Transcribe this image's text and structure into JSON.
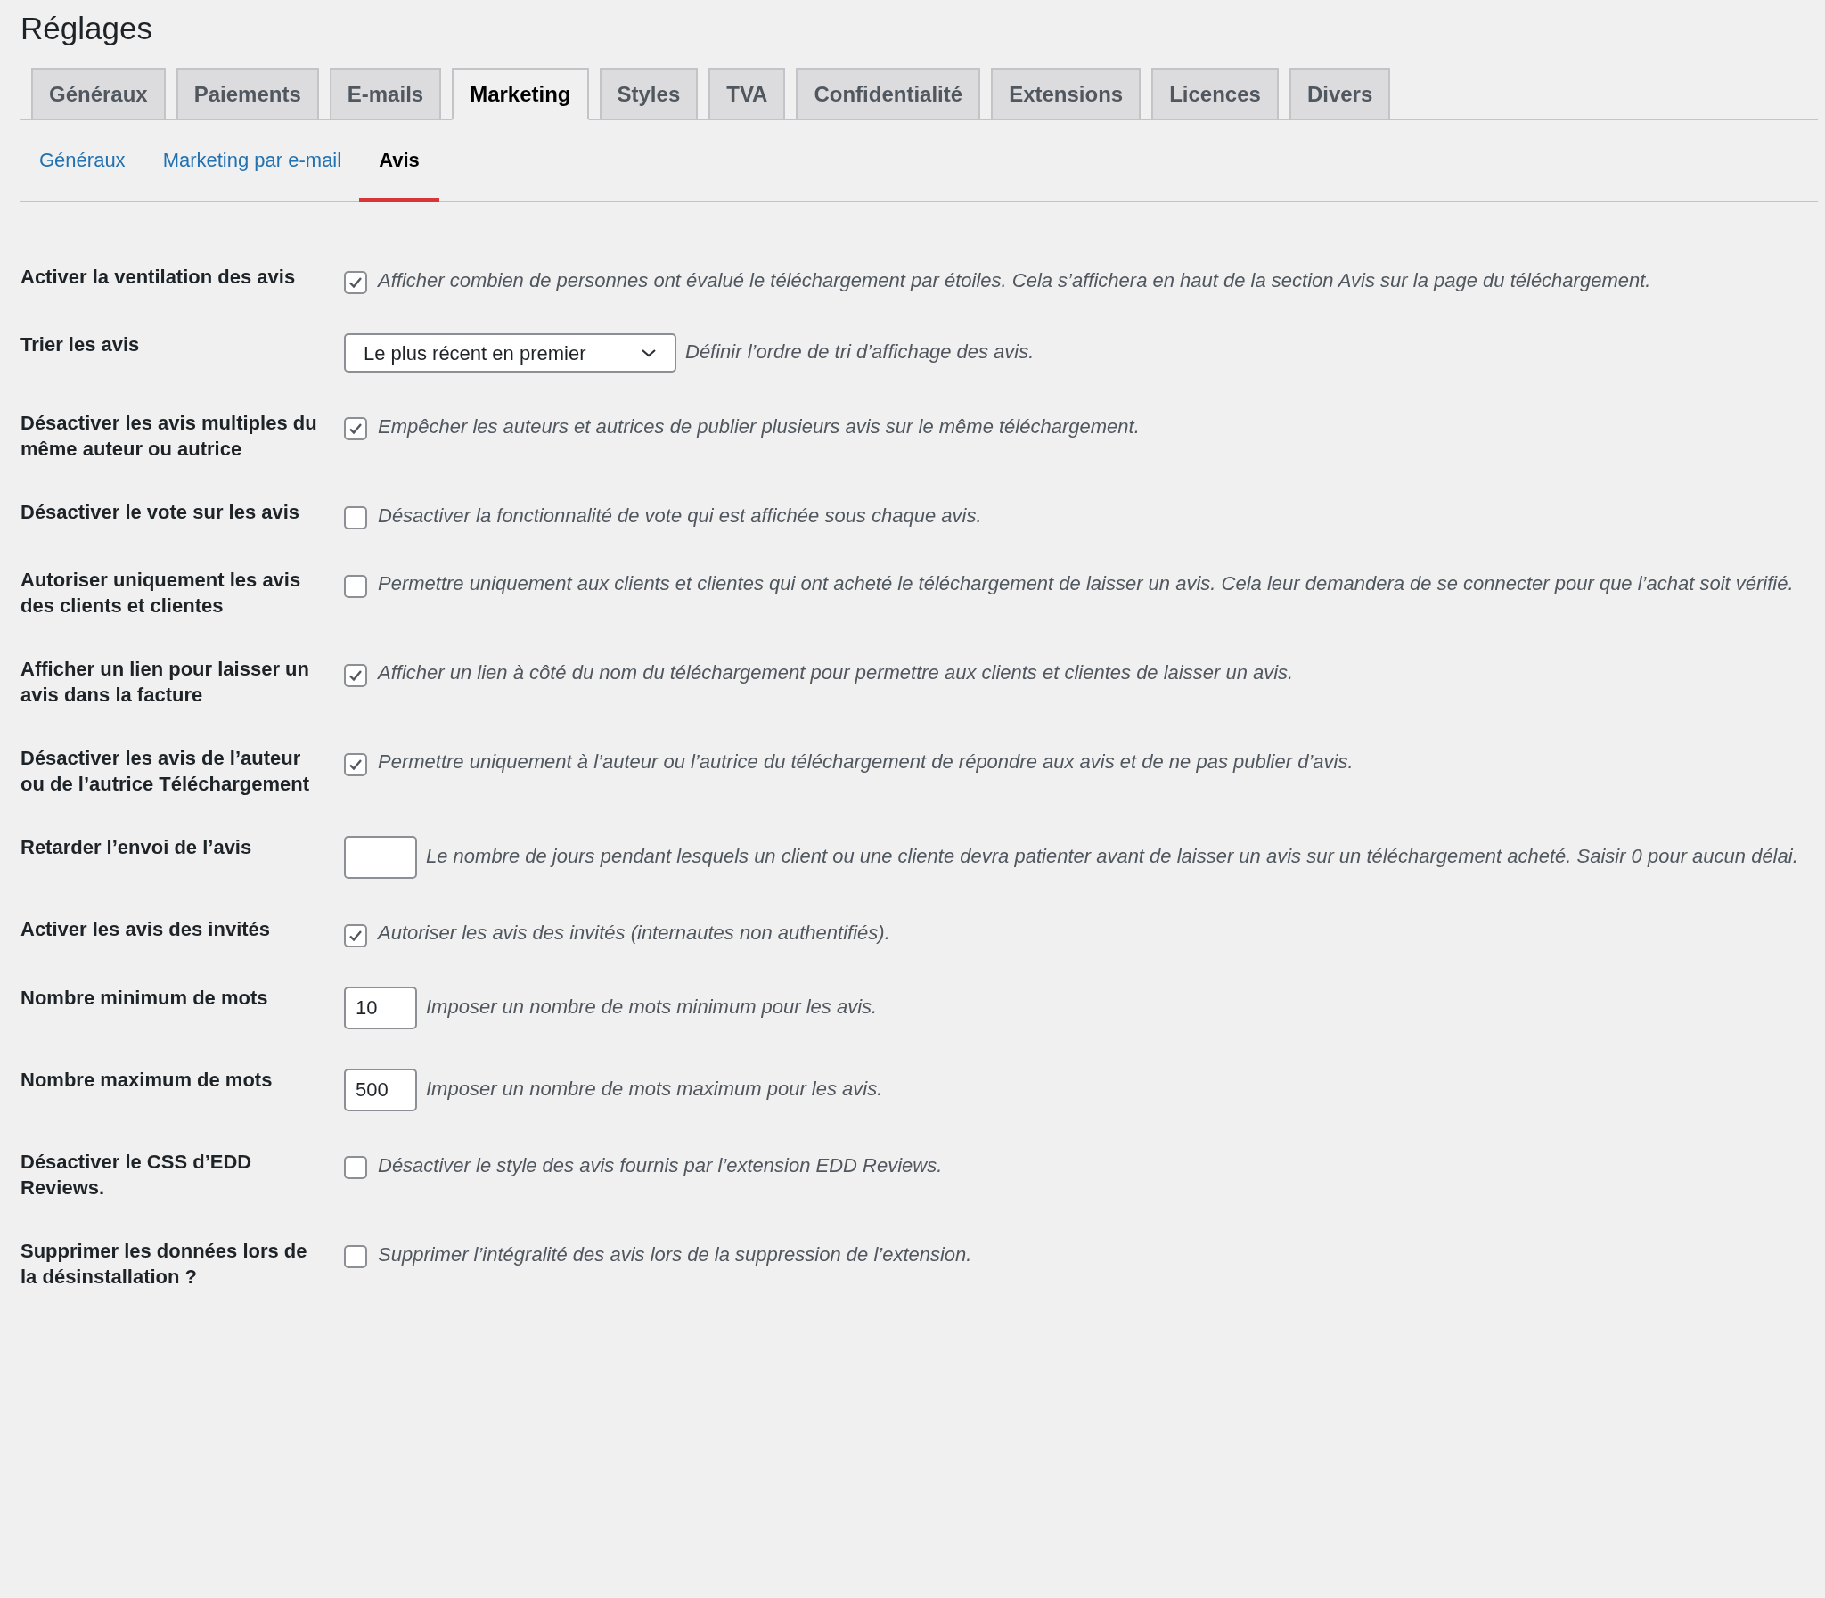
{
  "title": "Réglages",
  "tabs": [
    {
      "label": "Généraux",
      "selected": false
    },
    {
      "label": "Paiements",
      "selected": false
    },
    {
      "label": "E-mails",
      "selected": false
    },
    {
      "label": "Marketing",
      "selected": true
    },
    {
      "label": "Styles",
      "selected": false
    },
    {
      "label": "TVA",
      "selected": false
    },
    {
      "label": "Confidentialité",
      "selected": false
    },
    {
      "label": "Extensions",
      "selected": false
    },
    {
      "label": "Licences",
      "selected": false
    },
    {
      "label": "Divers",
      "selected": false
    }
  ],
  "subtabs": [
    {
      "label": "Généraux",
      "selected": false
    },
    {
      "label": "Marketing par e-mail",
      "selected": false
    },
    {
      "label": "Avis",
      "selected": true
    }
  ],
  "settings": [
    {
      "label": "Activer la ventilation des avis",
      "kind": "checkbox",
      "checked": true,
      "description": "Afficher combien de personnes ont évalué le téléchargement par étoiles. Cela s’affichera en haut de la section Avis sur la page du téléchargement."
    },
    {
      "label": "Trier les avis",
      "kind": "select",
      "value": "Le plus récent en premier",
      "description": "Définir l’ordre de tri d’affichage des avis."
    },
    {
      "label": "Désactiver les avis multiples du même auteur ou autrice",
      "kind": "checkbox",
      "checked": true,
      "description": "Empêcher les auteurs et autrices de publier plusieurs avis sur le même téléchargement."
    },
    {
      "label": "Désactiver le vote sur les avis",
      "kind": "checkbox",
      "checked": false,
      "description": "Désactiver la fonctionnalité de vote qui est affichée sous chaque avis."
    },
    {
      "label": "Autoriser uniquement les avis des clients et clientes",
      "kind": "checkbox",
      "checked": false,
      "description": "Permettre uniquement aux clients et clientes qui ont acheté le téléchargement de laisser un avis. Cela leur demandera de se connecter pour que l’achat soit vérifié."
    },
    {
      "label": "Afficher un lien pour laisser un avis dans la facture",
      "kind": "checkbox",
      "checked": true,
      "description": "Afficher un lien à côté du nom du téléchargement pour permettre aux clients et clientes de laisser un avis."
    },
    {
      "label": "Désactiver les avis de l’auteur ou de l’autrice Téléchargement",
      "kind": "checkbox",
      "checked": true,
      "description": "Permettre uniquement à l’auteur ou l’autrice du téléchargement de répondre aux avis et de ne pas publier d’avis."
    },
    {
      "label": "Retarder l’envoi de l’avis",
      "kind": "number",
      "description": "Le nombre de jours pendant lesquels un client ou une cliente devra patienter avant de laisser un avis sur un téléchargement acheté. Saisir 0 pour aucun délai."
    },
    {
      "label": "Activer les avis des invités",
      "kind": "checkbox",
      "checked": true,
      "description": "Autoriser les avis des invités (internautes non authentifiés)."
    },
    {
      "label": "Nombre minimum de mots",
      "kind": "number",
      "value": "10",
      "description": "Imposer un nombre de mots minimum pour les avis."
    },
    {
      "label": "Nombre maximum de mots",
      "kind": "number",
      "value": "500",
      "description": "Imposer un nombre de mots maximum pour les avis."
    },
    {
      "label": "Désactiver le CSS d’EDD Reviews.",
      "kind": "checkbox",
      "checked": false,
      "description": "Désactiver le style des avis fournis par l’extension EDD Reviews."
    },
    {
      "label": "Supprimer les données lors de la désinstallation ?",
      "kind": "checkbox",
      "checked": false,
      "description": "Supprimer l’intégralité des avis lors de la suppression de l’extension."
    }
  ]
}
